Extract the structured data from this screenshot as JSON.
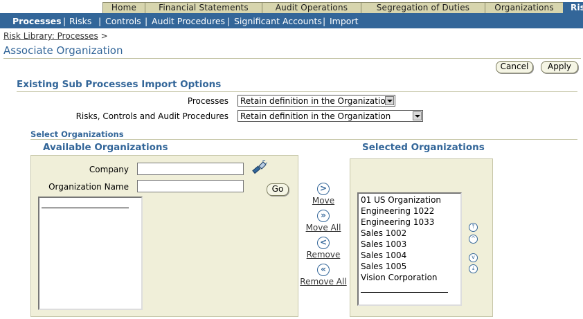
{
  "tabs": [
    {
      "label": "Home"
    },
    {
      "label": "Financial Statements"
    },
    {
      "label": "Audit Operations"
    },
    {
      "label": "Segregation of Duties"
    },
    {
      "label": "Organizations"
    },
    {
      "label": "Ris"
    }
  ],
  "subnav": {
    "items": [
      "Processes",
      "Risks",
      "Controls",
      "Audit Procedures",
      "Significant Accounts",
      "Import"
    ],
    "separator": "|"
  },
  "breadcrumb": {
    "link": "Risk Library: Processes",
    "arrow": ">"
  },
  "page_title": "Associate Organization",
  "buttons": {
    "cancel": "Cancel",
    "apply": "Apply",
    "go": "Go"
  },
  "import_options": {
    "title": "Existing Sub Processes Import Options",
    "processes_label": "Processes",
    "processes_value": "Retain definition in the Organization",
    "rcap_label": "Risks, Controls and Audit Procedures",
    "rcap_value": "Retain definition in the Organization"
  },
  "select_orgs": {
    "title": "Select Organizations",
    "available_title": "Available Organizations",
    "selected_title": "Selected Organizations",
    "company_label": "Company",
    "company_value": "",
    "org_name_label": "Organization Name",
    "org_name_value": "",
    "selected_items": [
      "01 US Organization",
      "Engineering 1022",
      "Engineering 1033",
      "Sales 1002",
      "Sales 1003",
      "Sales 1004",
      "Sales 1005",
      "Vision Corporation"
    ]
  },
  "shuttle": {
    "move": "Move",
    "move_all": "Move All",
    "remove": "Remove",
    "remove_all": "Remove All",
    "move_glyph": ">",
    "move_all_glyph": "»",
    "remove_glyph": "<",
    "remove_all_glyph": "«"
  },
  "reorder_glyphs": {
    "top": "⤒",
    "up": "^",
    "down": "v",
    "bottom": "⤓"
  },
  "icons": {
    "search": "flashlight-search-icon"
  }
}
